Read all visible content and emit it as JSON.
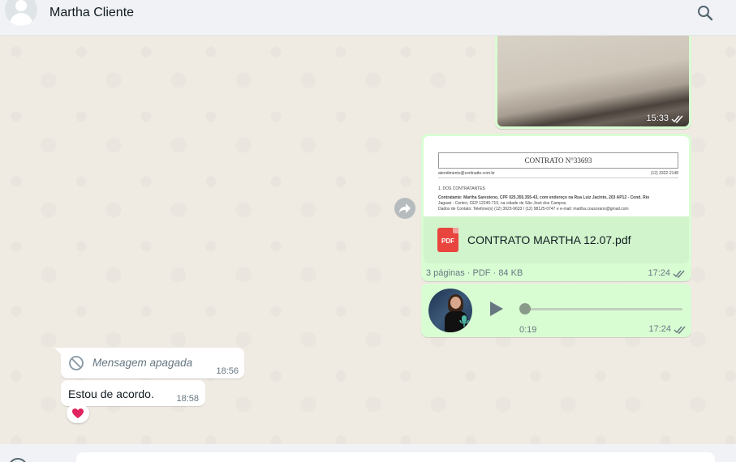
{
  "header": {
    "contact_name": "Martha Cliente",
    "avatar_icon": "default-user-avatar",
    "search_icon": "search-icon"
  },
  "messages": {
    "image": {
      "time": "15:33",
      "status": "read"
    },
    "document": {
      "preview_title": "CONTRATO N°33693",
      "preview_email": "atendimento@certinatto.com.br",
      "preview_phone": "(12) 3322-2148",
      "preview_section": "1. DOS CONTRATANTES",
      "preview_line1": "Contratante: Martha Saresteno, CPF 025.355.355-43, com endereço na Rua Luiz Jacinto, 203 AP12 - Cond. Rio",
      "preview_line2": "Jaguari - Centro, CEP 12245-710, na cidade de São José dos Campos.",
      "preview_line3": "Dados de Contato: Telefone(s) (12) 3923-9633 / (12) 98125-0747 e e-mail: martha.cousorano@gmail.com",
      "filename": "CONTRATO MARTHA 12.07.pdf",
      "file_icon_label": "PDF",
      "pages": "3 páginas",
      "type": "PDF",
      "size": "84 KB",
      "time": "17:24",
      "status": "read"
    },
    "audio": {
      "duration": "0:19",
      "time": "17:24",
      "status": "read",
      "progress": 0
    },
    "deleted": {
      "text": "Mensagem apagada",
      "time": "18:56"
    },
    "text_in": {
      "text": "Estou de acordo.",
      "time": "18:58",
      "reaction": "❤️"
    }
  },
  "colors": {
    "outgoing_bubble": "#d9fdd3",
    "incoming_bubble": "#ffffff",
    "chat_background": "#efeae2",
    "read_ticks": "#667781",
    "pdf_red": "#e9453f"
  }
}
